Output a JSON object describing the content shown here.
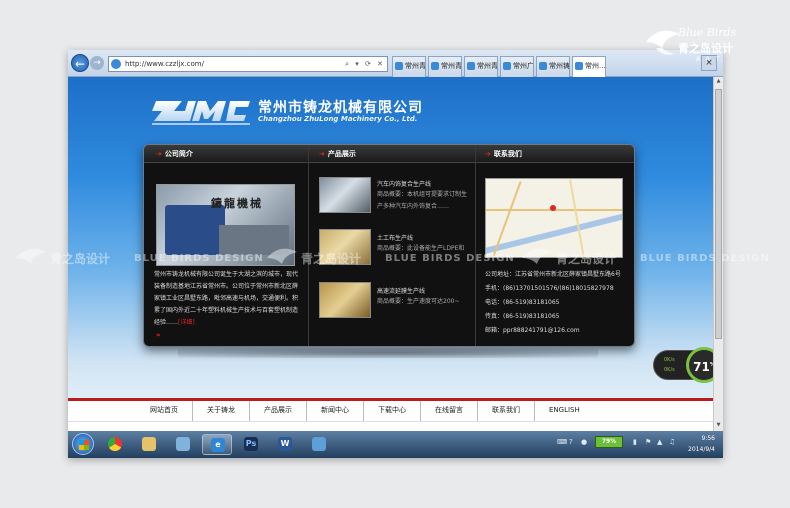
{
  "brand": {
    "script": "Blue Birds",
    "cn": "青之岛设计",
    "tags": "A.R.T.",
    "watermark_cn": "青之岛设计",
    "watermark_en": "BLUE BIRDS DESIGN"
  },
  "browser": {
    "url": "http://www.czzljx.com/",
    "controls": "⌕ ▾ ⟳ ✕",
    "tabs": [
      "常州青之...",
      "常州青之...",
      "常州青之...",
      "常州广告...",
      "常州铸龙...",
      "常州..."
    ],
    "close": "×"
  },
  "site": {
    "logo_text": "ZLMC",
    "company_cn": "常州市铸龙机械有限公司",
    "company_en": "Changzhou ZhuLong Machinery Co., Ltd.",
    "sections": {
      "about": "公司简介",
      "products": "产品展示",
      "contact": "联系我们"
    },
    "about": {
      "image_caption": "鑄龍機械",
      "text": "常州市铸龙机械有限公司诞生于大湖之滨的城市，现代装备制造基地江苏省常州市。公司位于常州市新北区薛家镇工业区昌墅东路，毗邻高速与机场，交通便利。积累了国内外近二十年塑料机械生产技术与百套塑机制造经验……",
      "more": "[详细]",
      "arrow": "»"
    },
    "products": [
      {
        "title": "汽车内饰复合生产线",
        "desc": "商品概要：本机组可提要求订制生产多种汽车内外饰复合……"
      },
      {
        "title": "土工布生产线",
        "desc": "商品概要：此设备能生产LDPE和"
      },
      {
        "title": "高速流延膜生产线",
        "desc": "商品概要：生产速度可达200~"
      }
    ],
    "contact": {
      "address": "公司地址：江苏省常州市新北区薛家镇昌墅东路6号",
      "mobile": "手机：(86)13701501576/(86)18015827978",
      "phone": "电话：(86-519)83181065",
      "fax": "传真：(86-519)83181065",
      "email": "邮箱：ppr888241791@126.com"
    },
    "nav": [
      "网站首页",
      "关于铸龙",
      "产品展示",
      "新闻中心",
      "下载中心",
      "在线留言",
      "联系我们",
      "ENGLISH"
    ]
  },
  "gauge": {
    "up": "0K/s",
    "down": "0K/s",
    "percent": "71",
    "unit": "%"
  },
  "taskbar": {
    "battery": "79%",
    "time": "9:56",
    "date": "2014/9/4"
  }
}
